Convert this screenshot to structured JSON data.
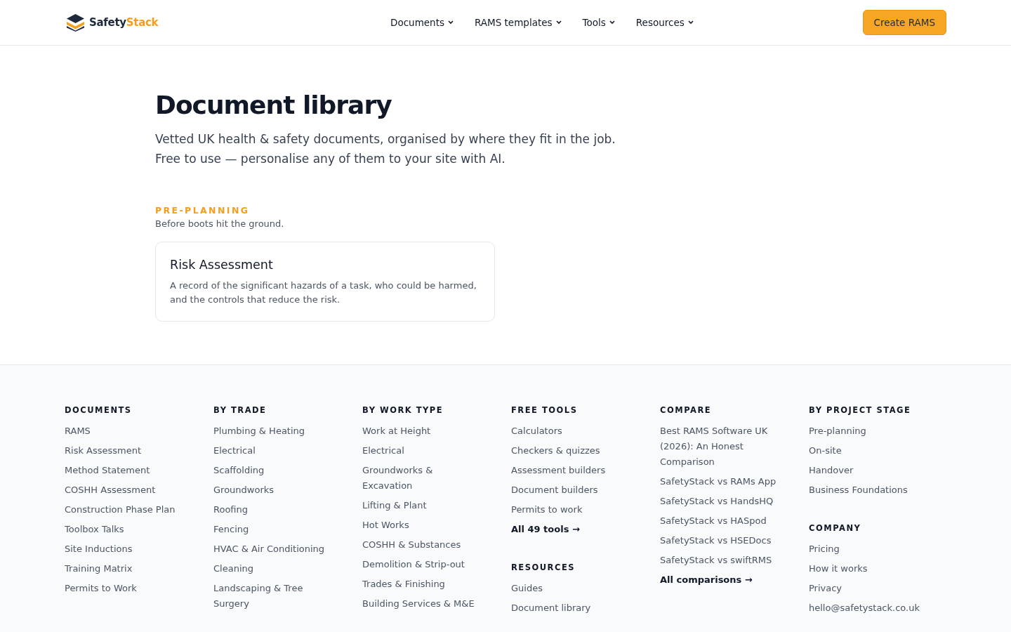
{
  "nav": {
    "logo": {
      "first": "Safety",
      "second": "Stack"
    },
    "menu": [
      {
        "label": "Documents"
      },
      {
        "label": "RAMS templates"
      },
      {
        "label": "Tools"
      },
      {
        "label": "Resources"
      }
    ],
    "cta": "Create RAMS"
  },
  "hero": {
    "title": "Document library",
    "intro": "Vetted UK health & safety documents, organised by where they fit in the job. Free to use — personalise any of them to your site with AI."
  },
  "sections": [
    {
      "label": "PRE-PLANNING",
      "subtitle": "Before boots hit the ground.",
      "cards": [
        {
          "title": "Risk Assessment",
          "description": "A record of the significant hazards of a task, who could be harmed, and the controls that reduce the risk."
        }
      ]
    }
  ],
  "footer": {
    "columns": [
      {
        "groups": [
          {
            "heading": "DOCUMENTS",
            "links": [
              {
                "label": "RAMS",
                "kind": "link"
              },
              {
                "label": "Risk Assessment",
                "kind": "link"
              },
              {
                "label": "Method Statement",
                "kind": "link"
              },
              {
                "label": "COSHH Assessment",
                "kind": "link"
              },
              {
                "label": "Construction Phase Plan",
                "kind": "link"
              },
              {
                "label": "Toolbox Talks",
                "kind": "link"
              },
              {
                "label": "Site Inductions",
                "kind": "link"
              },
              {
                "label": "Training Matrix",
                "kind": "link"
              },
              {
                "label": "Permits to Work",
                "kind": "link"
              }
            ]
          }
        ]
      },
      {
        "groups": [
          {
            "heading": "BY TRADE",
            "links": [
              {
                "label": "Plumbing & Heating",
                "kind": "link"
              },
              {
                "label": "Electrical",
                "kind": "link"
              },
              {
                "label": "Scaffolding",
                "kind": "link"
              },
              {
                "label": "Groundworks",
                "kind": "link"
              },
              {
                "label": "Roofing",
                "kind": "link"
              },
              {
                "label": "Fencing",
                "kind": "link"
              },
              {
                "label": "HVAC & Air Conditioning",
                "kind": "link"
              },
              {
                "label": "Cleaning",
                "kind": "link"
              },
              {
                "label": "Landscaping & Tree Surgery",
                "kind": "link"
              }
            ]
          }
        ]
      },
      {
        "groups": [
          {
            "heading": "BY WORK TYPE",
            "links": [
              {
                "label": "Work at Height",
                "kind": "link"
              },
              {
                "label": "Electrical",
                "kind": "link"
              },
              {
                "label": "Groundworks & Excavation",
                "kind": "link"
              },
              {
                "label": "Lifting & Plant",
                "kind": "link"
              },
              {
                "label": "Hot Works",
                "kind": "link"
              },
              {
                "label": "COSHH & Substances",
                "kind": "link"
              },
              {
                "label": "Demolition & Strip-out",
                "kind": "link"
              },
              {
                "label": "Trades & Finishing",
                "kind": "link"
              },
              {
                "label": "Building Services & M&E",
                "kind": "link"
              }
            ]
          }
        ]
      },
      {
        "groups": [
          {
            "heading": "FREE TOOLS",
            "links": [
              {
                "label": "Calculators",
                "kind": "link"
              },
              {
                "label": "Checkers & quizzes",
                "kind": "link"
              },
              {
                "label": "Assessment builders",
                "kind": "link"
              },
              {
                "label": "Document builders",
                "kind": "link"
              },
              {
                "label": "Permits to work",
                "kind": "link"
              },
              {
                "label": "All 49 tools →",
                "kind": "more"
              }
            ]
          },
          {
            "heading": "RESOURCES",
            "links": [
              {
                "label": "Guides",
                "kind": "link"
              },
              {
                "label": "Document library",
                "kind": "link"
              }
            ]
          }
        ]
      },
      {
        "groups": [
          {
            "heading": "COMPARE",
            "links": [
              {
                "label": "Best RAMS Software UK (2026): An Honest Comparison",
                "kind": "link"
              },
              {
                "label": "SafetyStack vs RAMs App",
                "kind": "link"
              },
              {
                "label": "SafetyStack vs HandsHQ",
                "kind": "link"
              },
              {
                "label": "SafetyStack vs HASpod",
                "kind": "link"
              },
              {
                "label": "SafetyStack vs HSEDocs",
                "kind": "link"
              },
              {
                "label": "SafetyStack vs swiftRMS",
                "kind": "link"
              },
              {
                "label": "All comparisons →",
                "kind": "more"
              }
            ]
          }
        ]
      },
      {
        "groups": [
          {
            "heading": "BY PROJECT STAGE",
            "links": [
              {
                "label": "Pre-planning",
                "kind": "link"
              },
              {
                "label": "On-site",
                "kind": "link"
              },
              {
                "label": "Handover",
                "kind": "link"
              },
              {
                "label": "Business Foundations",
                "kind": "link"
              }
            ]
          },
          {
            "heading": "COMPANY",
            "links": [
              {
                "label": "Pricing",
                "kind": "link"
              },
              {
                "label": "How it works",
                "kind": "link"
              },
              {
                "label": "Privacy",
                "kind": "link"
              },
              {
                "label": "hello@safetystack.co.uk",
                "kind": "link"
              }
            ]
          }
        ]
      }
    ]
  }
}
